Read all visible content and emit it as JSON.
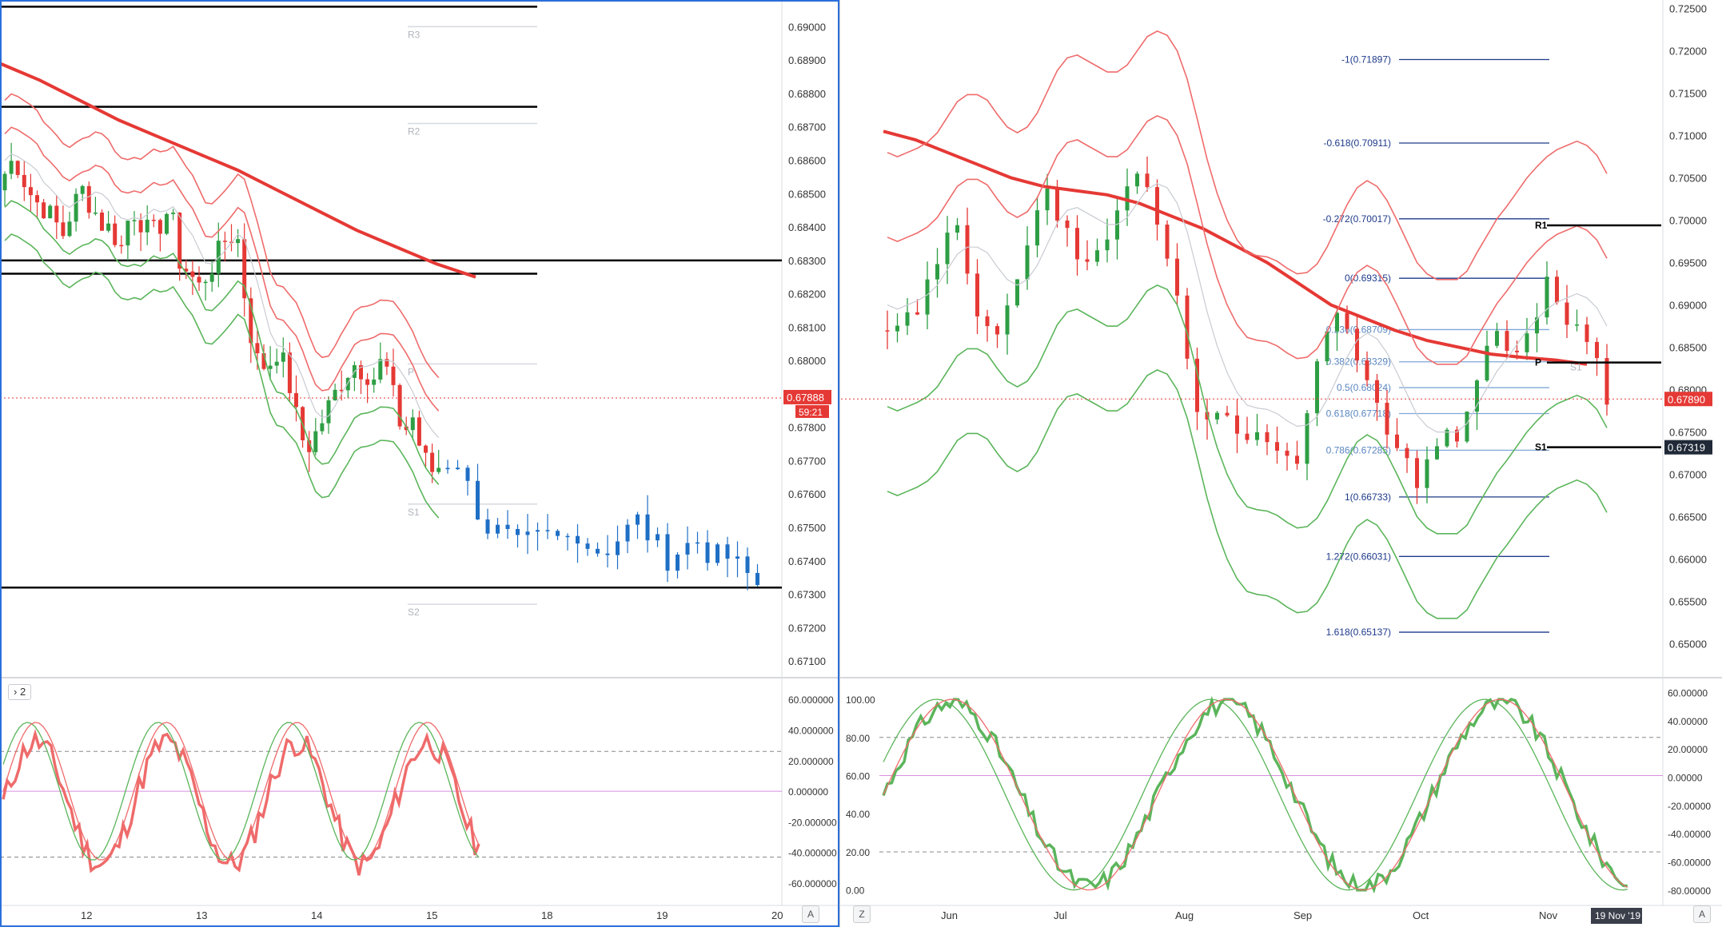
{
  "left_chart": {
    "price_ticks": [
      "0.69000",
      "0.68900",
      "0.68800",
      "0.68700",
      "0.68600",
      "0.68500",
      "0.68400",
      "0.68300",
      "0.68200",
      "0.68100",
      "0.68000",
      "0.67900",
      "0.67800",
      "0.67700",
      "0.67600",
      "0.67500",
      "0.67400",
      "0.67300",
      "0.67200",
      "0.67100"
    ],
    "date_ticks": [
      "12",
      "13",
      "14",
      "15",
      "18",
      "19",
      "20"
    ],
    "pivot_labels": [
      "R3",
      "R2",
      "P",
      "S1",
      "S2"
    ],
    "last_price": "0.67888",
    "countdown": "59:21",
    "indicator_chip": "2",
    "osc_ticks": [
      "60.000000",
      "40.000000",
      "20.000000",
      "0.000000",
      "-20.000000",
      "-40.000000",
      "-60.000000"
    ],
    "corner_label": "A"
  },
  "right_chart": {
    "price_ticks": [
      "0.72500",
      "0.72000",
      "0.71500",
      "0.71000",
      "0.70500",
      "0.70000",
      "0.69500",
      "0.69000",
      "0.68500",
      "0.68000",
      "0.67500",
      "0.67000",
      "0.66500",
      "0.66000",
      "0.65500",
      "0.65000"
    ],
    "date_ticks": [
      "Jun",
      "Jul",
      "Aug",
      "Sep",
      "Oct",
      "Nov"
    ],
    "fib_levels": [
      "-1(0.71897)",
      "-0.618(0.70911)",
      "-0.272(0.70017)",
      "0(0.69315)",
      "0.236(0.68709)",
      "0.382(0.68329)",
      "0.5(0.68024)",
      "0.618(0.67718)",
      "0.786(0.67285)",
      "1(0.66733)",
      "1.272(0.66031)",
      "1.618(0.65137)"
    ],
    "pivot_labels": [
      "R1",
      "P",
      "S1",
      "S1"
    ],
    "last_price": "0.67890",
    "s1_price": "0.67319",
    "date_cursor": "19 Nov '19",
    "osc_left_ticks": [
      "100.00",
      "80.00",
      "60.00",
      "40.00",
      "20.00",
      "0.00"
    ],
    "osc_right_ticks": [
      "60.00000",
      "40.00000",
      "20.00000",
      "0.00000",
      "-20.00000",
      "-40.00000",
      "-60.00000",
      "-80.00000"
    ],
    "corner_left": "Z",
    "corner_right": "A"
  },
  "colors": {
    "bull": "#2e9e44",
    "bear": "#e53935",
    "blue_bar": "#1f6fc5",
    "ma_red": "#e53935",
    "band_red": "#ef6b6b",
    "band_green": "#5bb55b",
    "level_black": "#000000",
    "fib_blue": "#1e3a8a",
    "axis_text": "#333333",
    "dotted_price": "#e53935"
  },
  "chart_data": [
    {
      "type": "line",
      "title": "",
      "xlabel": "",
      "ylabel": "",
      "x_ticks": [
        "12",
        "13",
        "14",
        "15",
        "18",
        "19",
        "20"
      ],
      "ylim": [
        0.6705,
        0.6908
      ],
      "horizontal_levels": [
        0.6906,
        0.6876,
        0.683,
        0.6826,
        0.6732
      ],
      "pivots": {
        "R3": 0.69,
        "R2": 0.6871,
        "P": 0.6799,
        "S1": 0.6757,
        "S2": 0.6727
      },
      "last_price": 0.67888,
      "series": [
        {
          "values": [
            0.6856,
            0.6861,
            0.6854,
            0.6848,
            0.6846,
            0.6842,
            0.6838,
            0.6846,
            0.6851,
            0.6846,
            0.6841,
            0.6839,
            0.6834,
            0.6846,
            0.6842,
            0.6837,
            0.6841,
            0.6846,
            0.683,
            0.6826,
            0.6822,
            0.6827,
            0.6832,
            0.6838,
            0.6836,
            0.6812,
            0.68,
            0.6798,
            0.6803,
            0.6797,
            0.6783,
            0.6773,
            0.6778,
            0.6784,
            0.679,
            0.6796,
            0.6799,
            0.6797,
            0.6795,
            0.6801,
            0.6789,
            0.6778,
            0.6783,
            0.6771,
            0.6767,
            0.6769,
            0.677,
            0.6758,
            0.675,
            0.6748,
            0.6744,
            0.6746,
            0.6747,
            0.6746,
            0.6749,
            0.6743,
            0.6744,
            0.6748,
            0.6752,
            0.6746,
            0.6741,
            0.6744,
            0.6746,
            0.6741,
            0.6741,
            0.6737,
            0.6733
          ]
        },
        {
          "values": [
            0.6889,
            0.6884,
            0.6878,
            0.6872,
            0.6867,
            0.6862,
            0.6857,
            0.6851,
            0.6845,
            0.6839,
            0.6834,
            0.6829,
            0.6825
          ]
        }
      ]
    },
    {
      "type": "line",
      "title": "",
      "xlabel": "",
      "ylabel": "",
      "x_ticks": [
        "Jun",
        "Jul",
        "Aug",
        "Sep",
        "Oct",
        "Nov"
      ],
      "ylim": [
        0.646,
        0.726
      ],
      "fibonacci": [
        {
          "level": "-1",
          "price": 0.71897
        },
        {
          "level": "-0.618",
          "price": 0.70911
        },
        {
          "level": "-0.272",
          "price": 0.70017
        },
        {
          "level": "0",
          "price": 0.69315
        },
        {
          "level": "0.236",
          "price": 0.68709
        },
        {
          "level": "0.382",
          "price": 0.68329
        },
        {
          "level": "0.5",
          "price": 0.68024
        },
        {
          "level": "0.618",
          "price": 0.67718
        },
        {
          "level": "0.786",
          "price": 0.67285
        },
        {
          "level": "1",
          "price": 0.66733
        },
        {
          "level": "1.272",
          "price": 0.66031
        },
        {
          "level": "1.618",
          "price": 0.65137
        }
      ],
      "pivots": {
        "R1": 0.6994,
        "P": 0.6832,
        "S1": 0.6732
      },
      "last_price": 0.6789,
      "series": [
        {
          "values": [
            0.688,
            0.687,
            0.689,
            0.69,
            0.692,
            0.696,
            0.699,
            0.698,
            0.694,
            0.69,
            0.688,
            0.686,
            0.69,
            0.694,
            0.698,
            0.7,
            0.703,
            0.701,
            0.699,
            0.696,
            0.694,
            0.696,
            0.699,
            0.701,
            0.704,
            0.706,
            0.704,
            0.7,
            0.696,
            0.69,
            0.684,
            0.678,
            0.675,
            0.676,
            0.677,
            0.676,
            0.675,
            0.676,
            0.674,
            0.673,
            0.672,
            0.672,
            0.676,
            0.682,
            0.686,
            0.688,
            0.687,
            0.684,
            0.681,
            0.678,
            0.676,
            0.674,
            0.672,
            0.669,
            0.673,
            0.674,
            0.676,
            0.674,
            0.678,
            0.682,
            0.685,
            0.686,
            0.685,
            0.684,
            0.688,
            0.69,
            0.692,
            0.691,
            0.688,
            0.687,
            0.685,
            0.683,
            0.679
          ]
        },
        {
          "values": [
            0.7105,
            0.7095,
            0.708,
            0.7065,
            0.705,
            0.704,
            0.7035,
            0.703,
            0.702,
            0.7005,
            0.699,
            0.697,
            0.695,
            0.6925,
            0.69,
            0.6885,
            0.687,
            0.6858,
            0.685,
            0.6842,
            0.6838,
            0.6835,
            0.683
          ]
        }
      ]
    }
  ]
}
